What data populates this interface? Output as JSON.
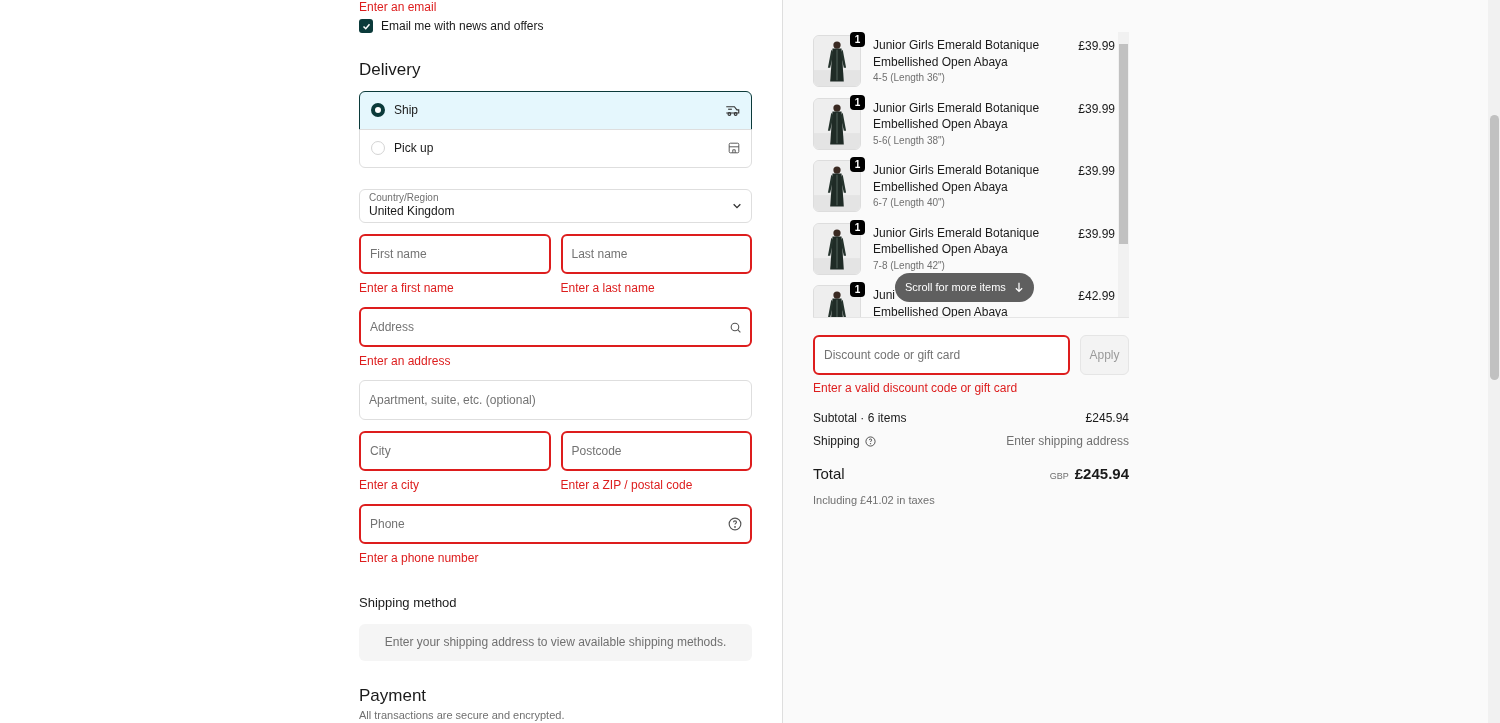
{
  "contact": {
    "error": "Enter an email",
    "newsletter": {
      "label": "Email me with news and offers",
      "checked": true
    }
  },
  "delivery": {
    "title": "Delivery",
    "options": [
      {
        "label": "Ship",
        "kind": "ship",
        "selected": true
      },
      {
        "label": "Pick up",
        "kind": "pickup",
        "selected": false
      }
    ]
  },
  "country": {
    "label": "Country/Region",
    "value": "United Kingdom"
  },
  "field_rows": [
    [
      {
        "placeholder": "First name",
        "kind": "plain",
        "invalid": true,
        "error": "Enter a first name"
      },
      {
        "placeholder": "Last name",
        "kind": "plain",
        "invalid": true,
        "error": "Enter a last name"
      }
    ],
    [
      {
        "placeholder": "Address",
        "kind": "search",
        "invalid": true,
        "error": "Enter an address"
      }
    ],
    [
      {
        "placeholder": "Apartment, suite, etc. (optional)",
        "kind": "plain",
        "invalid": false
      }
    ],
    [
      {
        "placeholder": "City",
        "kind": "plain",
        "invalid": true,
        "error": "Enter a city"
      },
      {
        "placeholder": "Postcode",
        "kind": "plain",
        "invalid": true,
        "error": "Enter a ZIP / postal code"
      }
    ],
    [
      {
        "placeholder": "Phone",
        "kind": "help",
        "invalid": true,
        "error": "Enter a phone number"
      }
    ]
  ],
  "shipping_method": {
    "title": "Shipping method",
    "notice": "Enter your shipping address to view available shipping methods."
  },
  "payment": {
    "title": "Payment",
    "subtitle": "All transactions are secure and encrypted."
  },
  "cart": {
    "items": [
      {
        "quantity": "1",
        "name_lines": [
          "Junior Girls Emerald Botanique",
          "Embellished Open Abaya"
        ],
        "variant": "4-5 (Length 36\")",
        "price": "£39.99"
      },
      {
        "quantity": "1",
        "name_lines": [
          "Junior Girls Emerald Botanique",
          "Embellished Open Abaya"
        ],
        "variant": "5-6( Length 38\")",
        "price": "£39.99"
      },
      {
        "quantity": "1",
        "name_lines": [
          "Junior Girls Emerald Botanique",
          "Embellished Open Abaya"
        ],
        "variant": "6-7 (Length 40\")",
        "price": "£39.99"
      },
      {
        "quantity": "1",
        "name_lines": [
          "Junior Girls Emerald Botanique",
          "Embellished Open Abaya"
        ],
        "variant": "7-8 (Length 42\")",
        "price": "£39.99"
      },
      {
        "quantity": "1",
        "name_lines": [
          "Juni",
          "Embellished Open Abaya"
        ],
        "price": "£42.99"
      }
    ],
    "scroll_hint": "Scroll for more items",
    "discount": {
      "placeholder": "Discount code or gift card",
      "invalid": true,
      "error": "Enter a valid discount code or gift card",
      "button": "Apply"
    },
    "subtotal": {
      "label": "Subtotal · 6 items",
      "value": "£245.94"
    },
    "shipping": {
      "label": "Shipping",
      "value": "Enter shipping address"
    },
    "total": {
      "label": "Total",
      "currency": "GBP",
      "value": "£245.94",
      "taxes": "Including £41.02 in taxes"
    }
  }
}
